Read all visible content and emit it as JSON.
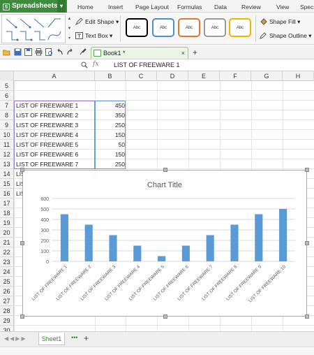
{
  "app": {
    "name": "Spreadsheets"
  },
  "menu_tabs": [
    "Home",
    "Insert",
    "Page Layout",
    "Formulas",
    "Data",
    "Review",
    "View",
    "Spec"
  ],
  "ribbon": {
    "edit_shape_label": "Edit Shape",
    "text_box_label": "Text Box",
    "style_swatches": [
      {
        "label": "Abc",
        "color": "#000000"
      },
      {
        "label": "Abc",
        "color": "#4a90d9"
      },
      {
        "label": "Abc",
        "color": "#e07a2e"
      },
      {
        "label": "Abc",
        "color": "#9a9a9a"
      },
      {
        "label": "Abc",
        "color": "#f0b400"
      }
    ],
    "shape_fill_label": "Shape Fill",
    "shape_outline_label": "Shape Outline"
  },
  "document": {
    "tab_label": "Book1 *"
  },
  "formula_bar": {
    "fx_label": "fx",
    "value": "LIST OF FREEWARE 1"
  },
  "columns": [
    "A",
    "B",
    "C",
    "D",
    "E",
    "F",
    "G",
    "H"
  ],
  "rows": [
    "5",
    "6",
    "7",
    "8",
    "9",
    "10",
    "11",
    "12",
    "13",
    "14",
    "15",
    "16",
    "17",
    "18",
    "19",
    "20",
    "21",
    "22",
    "23",
    "24",
    "25",
    "26",
    "27",
    "28",
    "29",
    "30"
  ],
  "cells": [
    {
      "a": "LIST OF FREEWARE 1",
      "b": "450"
    },
    {
      "a": "LIST OF FREEWARE 2",
      "b": "350"
    },
    {
      "a": "LIST OF FREEWARE 3",
      "b": "250"
    },
    {
      "a": "LIST OF FREEWARE 4",
      "b": "150"
    },
    {
      "a": "LIST OF FREEWARE 5",
      "b": "50"
    },
    {
      "a": "LIST OF FREEWARE 6",
      "b": "150"
    },
    {
      "a": "LIST OF FREEWARE 7",
      "b": "250"
    },
    {
      "a": "LIS",
      "b": ""
    },
    {
      "a": "LIS",
      "b": ""
    },
    {
      "a": "LIS",
      "b": ""
    }
  ],
  "chart_data": {
    "type": "bar",
    "title": "Chart Title",
    "categories": [
      "LIST OF FREEWARE 1",
      "LIST OF FREEWARE 2",
      "LIST OF FREEWARE 3",
      "LIST OF FREEWARE 4",
      "LIST OF FREEWARE 5",
      "LIST OF FREEWARE 6",
      "LIST OF FREEWARE 7",
      "LIST OF FREEWARE 8",
      "LIST OF FREEWARE 9",
      "LIST OF FREEWARE 10"
    ],
    "values": [
      450,
      350,
      250,
      150,
      50,
      150,
      250,
      350,
      450,
      500
    ],
    "ylim": [
      0,
      600
    ],
    "yticks": [
      0,
      100,
      200,
      300,
      400,
      500,
      600
    ],
    "grid": true,
    "bar_color": "#5b9bd5"
  },
  "sheets": [
    "Sheet1"
  ],
  "colors": {
    "app_green": "#3d8b3d",
    "selection_purple": "#9b7fc7",
    "selection_blue": "#6f9fd8"
  }
}
